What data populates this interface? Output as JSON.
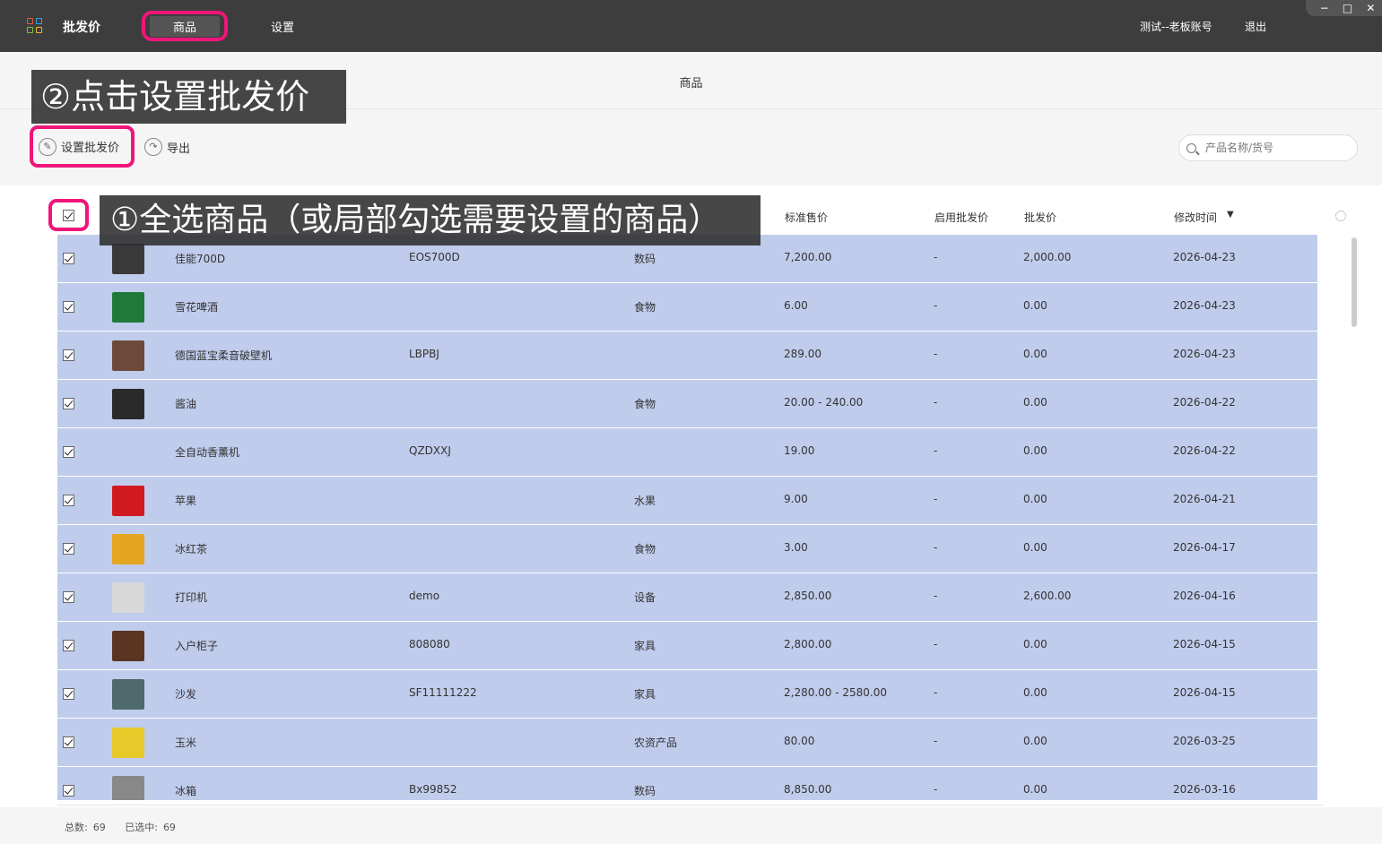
{
  "topbar": {
    "app_name": "批发价",
    "tabs": [
      "商品",
      "设置"
    ],
    "account": "测试--老板账号",
    "logout": "退出",
    "window_controls": [
      "−",
      "□",
      "✕"
    ]
  },
  "page": {
    "title": "商品"
  },
  "callouts": {
    "step2": "②点击设置批发价",
    "step1": "①全选商品（或局部勾选需要设置的商品）"
  },
  "toolbar": {
    "set_price_label": "设置批发价",
    "export_label": "导出",
    "search_placeholder": "产品名称/货号"
  },
  "table": {
    "headers": {
      "price": "标准售价",
      "enable_wholesale": "启用批发价",
      "wholesale": "批发价",
      "modified": "修改时间",
      "sort_indicator": "▼"
    },
    "rows": [
      {
        "name": "佳能700D",
        "code": "EOS700D",
        "category": "数码",
        "price": "7,200.00",
        "enabled": "-",
        "wholesale": "2,000.00",
        "date": "2026-04-23",
        "thumb_color": "#3a3a3a"
      },
      {
        "name": "雪花啤酒",
        "code": "",
        "category": "食物",
        "price": "6.00",
        "enabled": "-",
        "wholesale": "0.00",
        "date": "2026-04-23",
        "thumb_color": "#1f7a3a"
      },
      {
        "name": "德国蓝宝柔音破壁机",
        "code": "LBPBJ",
        "category": "",
        "price": "289.00",
        "enabled": "-",
        "wholesale": "0.00",
        "date": "2026-04-23",
        "thumb_color": "#6b4a3a"
      },
      {
        "name": "酱油",
        "code": "",
        "category": "食物",
        "price": "20.00 - 240.00",
        "enabled": "-",
        "wholesale": "0.00",
        "date": "2026-04-22",
        "thumb_color": "#2a2a2a"
      },
      {
        "name": "全自动香薰机",
        "code": "QZDXXJ",
        "category": "",
        "price": "19.00",
        "enabled": "-",
        "wholesale": "0.00",
        "date": "2026-04-22",
        "thumb_color": ""
      },
      {
        "name": "苹果",
        "code": "",
        "category": "水果",
        "price": "9.00",
        "enabled": "-",
        "wholesale": "0.00",
        "date": "2026-04-21",
        "thumb_color": "#d01a20"
      },
      {
        "name": "冰红茶",
        "code": "",
        "category": "食物",
        "price": "3.00",
        "enabled": "-",
        "wholesale": "0.00",
        "date": "2026-04-17",
        "thumb_color": "#e6a520"
      },
      {
        "name": "打印机",
        "code": "demo",
        "category": "设备",
        "price": "2,850.00",
        "enabled": "-",
        "wholesale": "2,600.00",
        "date": "2026-04-16",
        "thumb_color": "#d8d8d8"
      },
      {
        "name": "入户柜子",
        "code": "808080",
        "category": "家具",
        "price": "2,800.00",
        "enabled": "-",
        "wholesale": "0.00",
        "date": "2026-04-15",
        "thumb_color": "#5a3522"
      },
      {
        "name": "沙发",
        "code": "SF11111222",
        "category": "家具",
        "price": "2,280.00 - 2580.00",
        "enabled": "-",
        "wholesale": "0.00",
        "date": "2026-04-15",
        "thumb_color": "#4f6a6a"
      },
      {
        "name": "玉米",
        "code": "",
        "category": "农资产品",
        "price": "80.00",
        "enabled": "-",
        "wholesale": "0.00",
        "date": "2026-03-25",
        "thumb_color": "#e8c92a"
      },
      {
        "name": "冰箱",
        "code": "Bx99852",
        "category": "数码",
        "price": "8,850.00",
        "enabled": "-",
        "wholesale": "0.00",
        "date": "2026-03-16",
        "thumb_color": "#888888"
      }
    ]
  },
  "footer": {
    "total_label": "总数:",
    "total": "69",
    "selected_label": "已选中:",
    "selected": "69"
  }
}
